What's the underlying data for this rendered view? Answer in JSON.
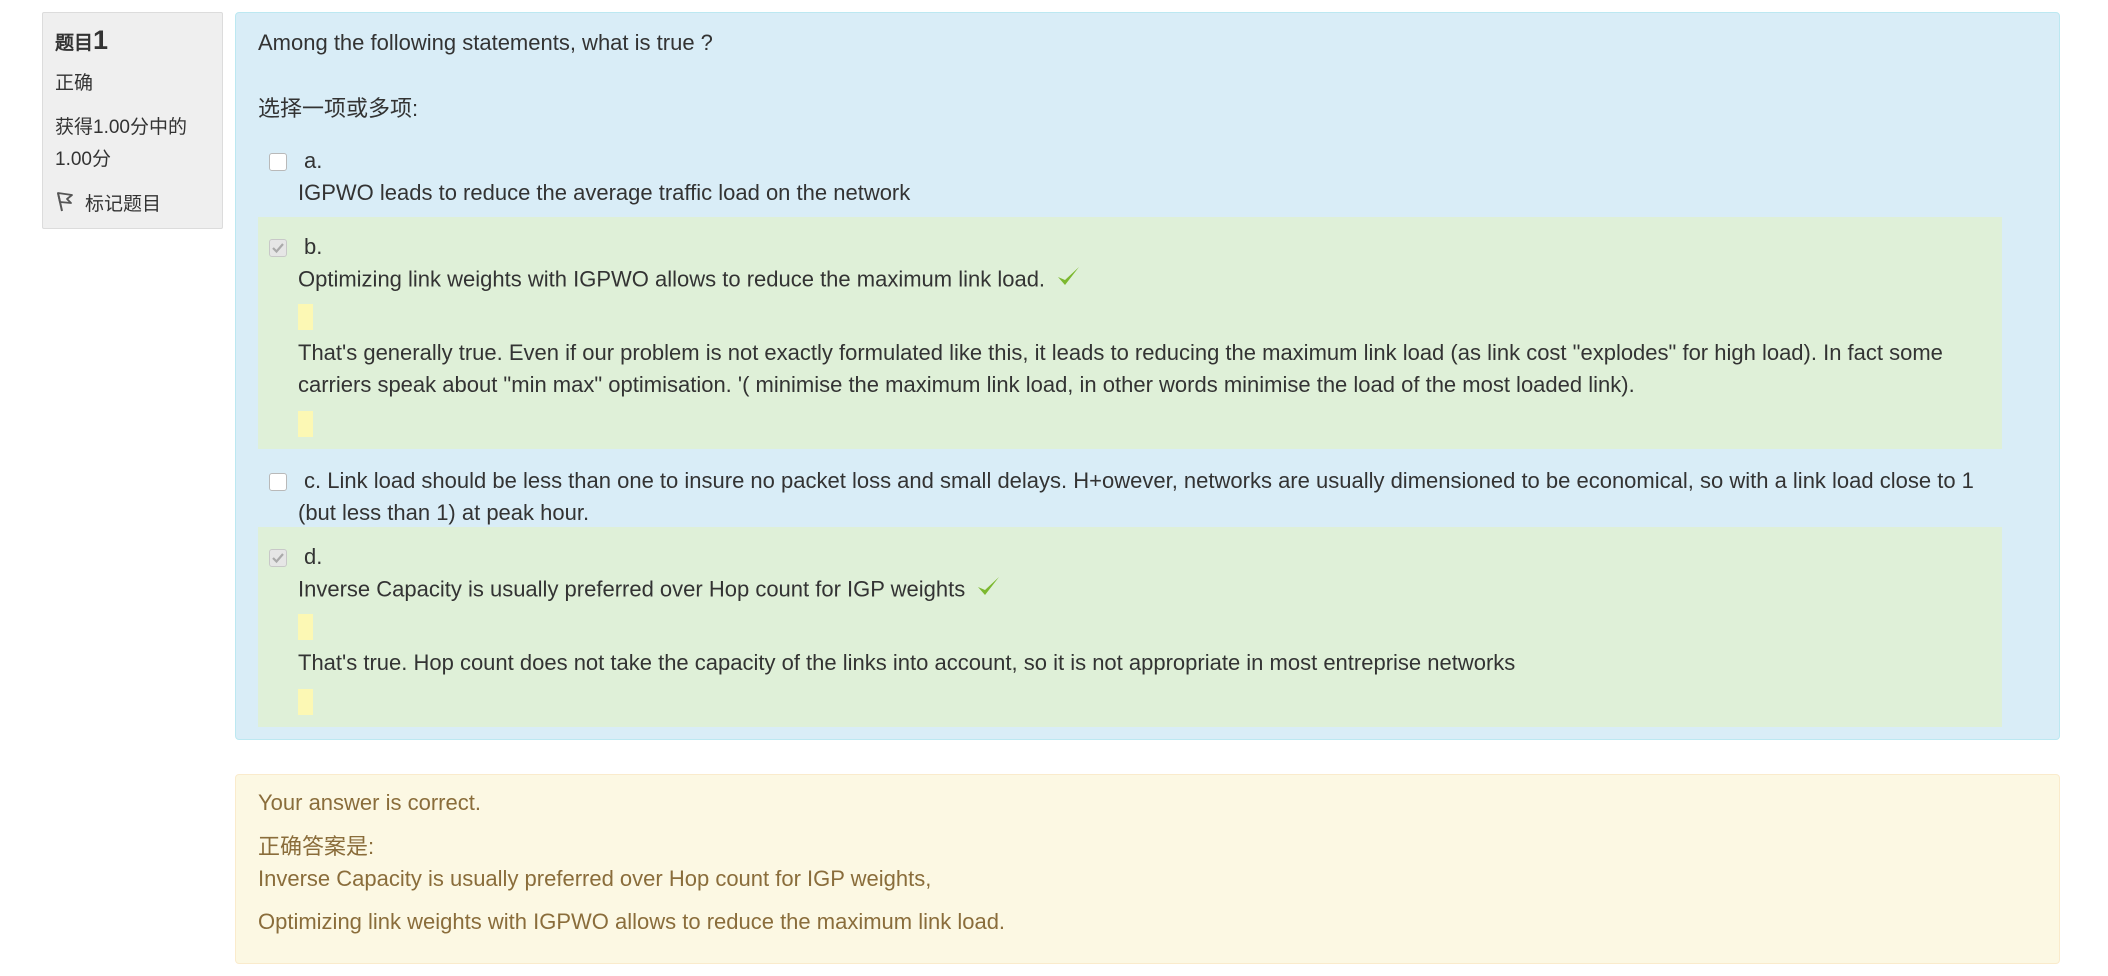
{
  "info": {
    "question_label": "题目",
    "question_number": "1",
    "state": "正确",
    "grade": "获得1.00分中的1.00分",
    "flag_label": "标记题目"
  },
  "question": {
    "text": "Among the following statements, what is true ?",
    "prompt": "选择一项或多项:",
    "answers": [
      {
        "letter": "a.",
        "text": "IGPWO leads to reduce the average traffic load on the network",
        "checked": false
      },
      {
        "letter": "b.",
        "text": "Optimizing link weights with IGPWO allows to reduce the maximum link load.",
        "checked": true,
        "feedback": "That's generally true. Even if our problem is not exactly formulated like this, it leads to reducing the maximum link load (as link cost \"explodes\" for high load). In fact some carriers speak about \"min max\" optimisation. '( minimise the maximum link load, in other words minimise the load of the most loaded link)."
      },
      {
        "letter": "c.",
        "text": "Link load should be less than one to insure no packet loss and small delays. H+owever, networks are usually dimensioned to be economical, so with a link load close to 1 (but less than 1) at peak hour.",
        "checked": false
      },
      {
        "letter": "d.",
        "text": "Inverse Capacity is usually preferred over Hop count for IGP weights",
        "checked": true,
        "feedback": "That's true. Hop count does not take the capacity of the links into account, so it is not appropriate in most entreprise networks"
      }
    ]
  },
  "outcome": {
    "status": "Your answer is correct.",
    "right_answer_label": "正确答案是:",
    "right_answer_1": "Inverse Capacity is usually preferred over Hop count for IGP weights,",
    "right_answer_2": "Optimizing link weights with IGPWO allows to reduce the maximum link load."
  },
  "colors": {
    "question_bg": "#d9edf7",
    "correct_bg": "#dff0d8",
    "outcome_bg": "#fcf8e3",
    "outcome_text": "#8a6d3b",
    "tick": "#7cb82f",
    "highlight": "#fcf8b4"
  },
  "icons": {
    "flag": "flag-icon",
    "tick": "check-icon"
  }
}
